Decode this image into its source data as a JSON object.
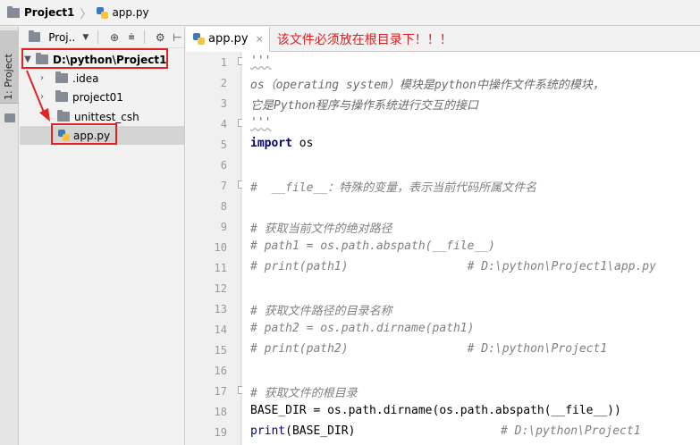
{
  "breadcrumb": {
    "project": "Project1",
    "file": "app.py"
  },
  "tool_strip": {
    "project_tab": "1: Project"
  },
  "project_panel": {
    "toolbar_label": "Proj..",
    "tree": [
      {
        "label": "D:\\python\\Project1",
        "type": "folder",
        "expanded": true,
        "bold": true
      },
      {
        "label": ".idea",
        "type": "folder"
      },
      {
        "label": "project01",
        "type": "folder"
      },
      {
        "label": "unittest_csh",
        "type": "folder"
      },
      {
        "label": "app.py",
        "type": "python-file",
        "selected": true
      }
    ]
  },
  "editor": {
    "tab_label": "app.py",
    "annotation": "该文件必须放在根目录下！！！",
    "lines": [
      {
        "n": "1",
        "text": "'''"
      },
      {
        "n": "2",
        "text": "os（operating system）模块是python中操作文件系统的模块，"
      },
      {
        "n": "3",
        "text": "它是Python程序与操作系统进行交互的接口"
      },
      {
        "n": "4",
        "text": "'''"
      },
      {
        "n": "5",
        "text": "os"
      },
      {
        "n": "6",
        "text": ""
      },
      {
        "n": "7",
        "text": "#  __file__：特殊的变量，表示当前代码所属文件名"
      },
      {
        "n": "8",
        "text": ""
      },
      {
        "n": "9",
        "text": "# 获取当前文件的绝对路径"
      },
      {
        "n": "10",
        "text": "# path1 = os.path.abspath(__file__)"
      },
      {
        "n": "11",
        "text": "# print(path1)                 # D:\\python\\Project1\\app.py"
      },
      {
        "n": "12",
        "text": ""
      },
      {
        "n": "13",
        "text": "# 获取文件路径的目录名称"
      },
      {
        "n": "14",
        "text": "# path2 = os.path.dirname(path1)"
      },
      {
        "n": "15",
        "text": "# print(path2)                 # D:\\python\\Project1"
      },
      {
        "n": "16",
        "text": ""
      },
      {
        "n": "17",
        "text": "# 获取文件的根目录"
      },
      {
        "n": "18",
        "text": "BASE_DIR = os.path.dirname(os.path.abspath(__file__))"
      },
      {
        "n": "19",
        "text": "(BASE_DIR)"
      },
      {
        "n": "19c",
        "text": "# D:\\python\\Project1"
      }
    ],
    "keywords": {
      "import": "import",
      "print": "print"
    }
  },
  "colors": {
    "highlight": "#e52222",
    "annotation": "#e02020",
    "keyword": "#000080",
    "comment": "#808080"
  }
}
